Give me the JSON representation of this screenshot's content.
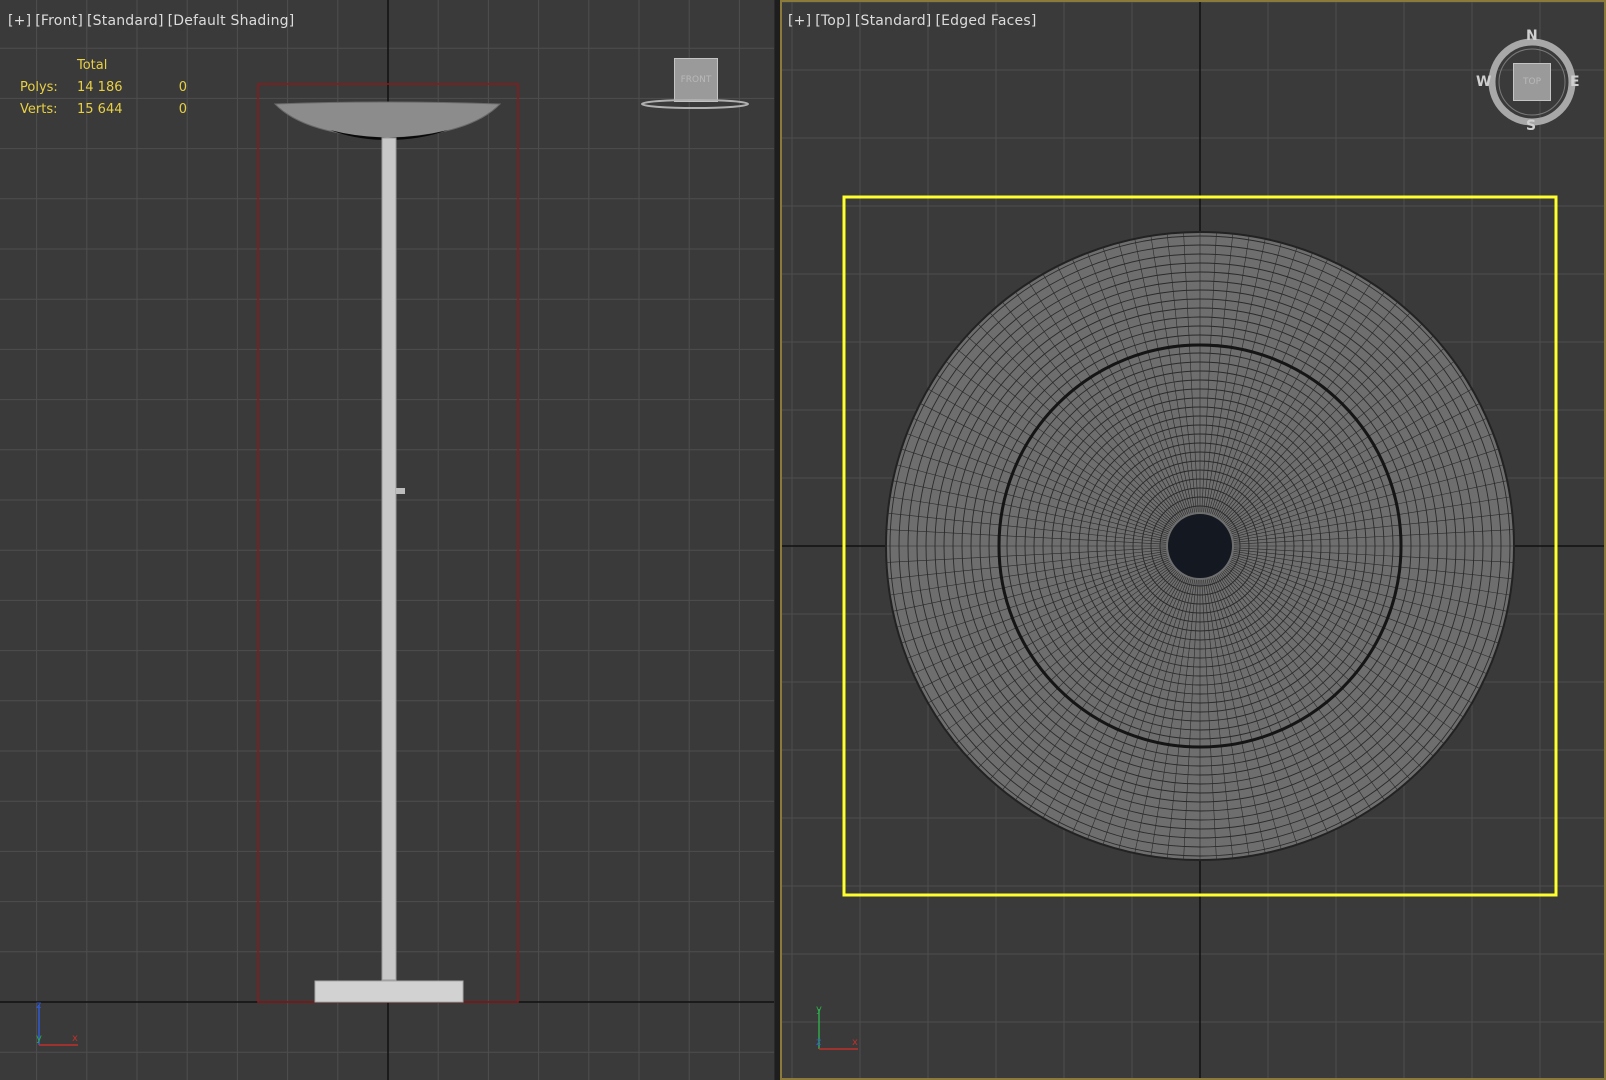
{
  "front_viewport": {
    "label": [
      "[+]",
      "[Front]",
      "[Standard]",
      "[Default Shading]"
    ],
    "viewcube_label": "FRONT"
  },
  "top_viewport": {
    "label": [
      "[+]",
      "[Top]",
      "[Standard]",
      "[Edged Faces]"
    ],
    "viewcube_label": "TOP",
    "compass": {
      "n": "N",
      "s": "S",
      "e": "E",
      "w": "W"
    }
  },
  "stats": {
    "header": "Total",
    "rows": [
      {
        "label": "Polys:",
        "total": "14 186",
        "selected": "0"
      },
      {
        "label": "Verts:",
        "total": "15 644",
        "selected": "0"
      }
    ]
  },
  "axis_tripod": {
    "x": "x",
    "y": "y",
    "z": "z"
  },
  "colors": {
    "viewport_bg": "#3a3a3a",
    "grid": "#4e4e4e",
    "stats_text": "#e8d044",
    "selection_box": "#ffff2e",
    "bounding_box": "#8a1a1a",
    "active_border": "#8b7a3a"
  }
}
